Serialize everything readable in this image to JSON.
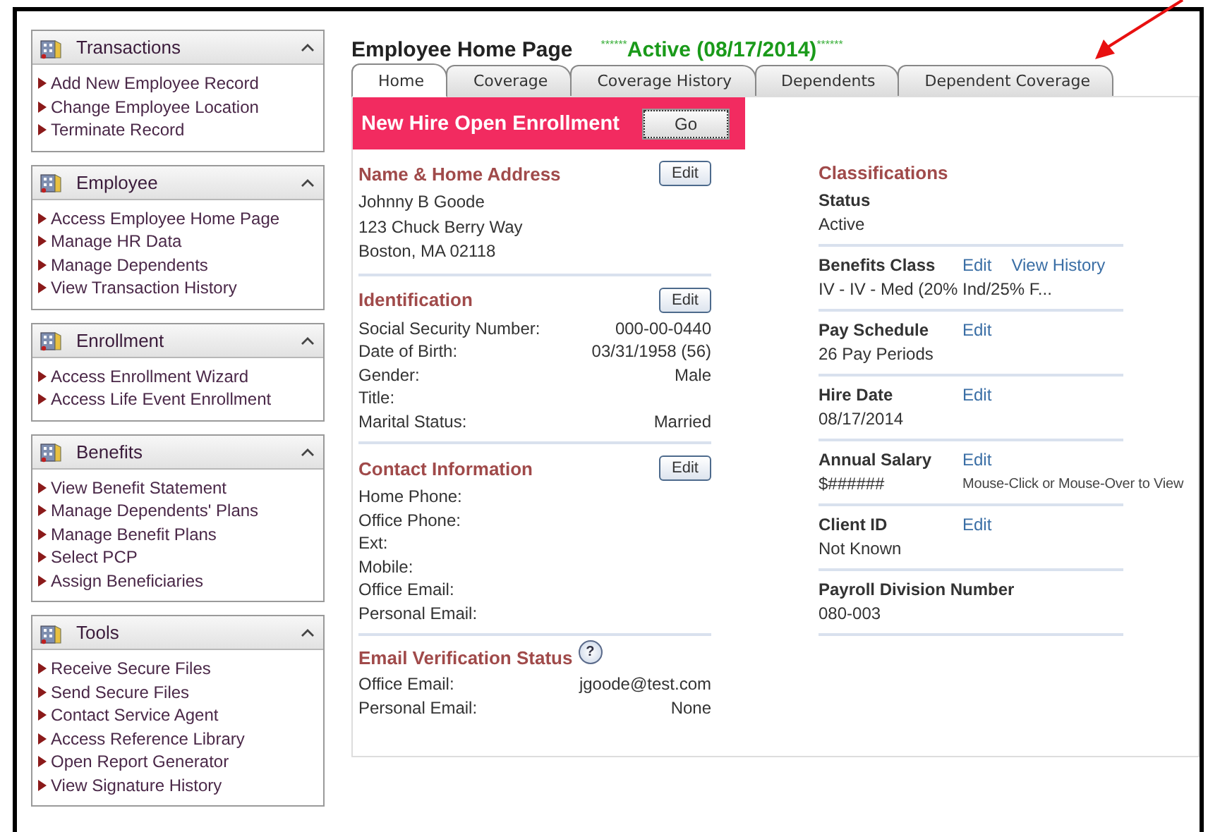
{
  "sidebar": {
    "panels": [
      {
        "title": "Transactions",
        "expanded": true,
        "items": [
          "Add New Employee Record",
          "Change Employee Location",
          "Terminate Record"
        ]
      },
      {
        "title": "Employee",
        "expanded": true,
        "items": [
          "Access Employee Home Page",
          "Manage HR Data",
          "Manage Dependents",
          "View Transaction History"
        ]
      },
      {
        "title": "Enrollment",
        "expanded": true,
        "items": [
          "Access Enrollment Wizard",
          "Access Life Event Enrollment"
        ]
      },
      {
        "title": "Benefits",
        "expanded": true,
        "items": [
          "View Benefit Statement",
          "Manage Dependents' Plans",
          "Manage Benefit Plans",
          "Select PCP",
          "Assign Beneficiaries"
        ]
      },
      {
        "title": "Tools",
        "expanded": true,
        "items": [
          "Receive Secure Files",
          "Send Secure Files",
          "Contact Service Agent",
          "Access Reference Library",
          "Open Report Generator",
          "View Signature History"
        ]
      }
    ]
  },
  "main": {
    "title": "Employee Home Page",
    "status": {
      "prefix": "******",
      "text": "Active (08/17/2014)",
      "suffix": "******"
    },
    "tabs": [
      {
        "label": "Home",
        "selected": true
      },
      {
        "label": "Coverage",
        "selected": false
      },
      {
        "label": "Coverage History",
        "selected": false
      },
      {
        "label": "Dependents",
        "selected": false
      },
      {
        "label": "Dependent Coverage",
        "selected": false
      }
    ],
    "banner": {
      "text": "New Hire Open Enrollment",
      "button": "Go"
    },
    "left_sections": [
      {
        "title": "Name & Home Address",
        "button": "Edit",
        "lines": [
          "Johnny B Goode",
          "123 Chuck Berry Way",
          "Boston, MA 02118"
        ]
      },
      {
        "title": "Identification",
        "button": "Edit",
        "rows": [
          {
            "label": "Social Security Number:",
            "value": "000-00-0440"
          },
          {
            "label": "Date of Birth:",
            "value": "03/31/1958 (56)"
          },
          {
            "label": "Gender:",
            "value": "Male"
          },
          {
            "label": "Title:"
          },
          {
            "label": "Marital Status:",
            "value": "Married"
          }
        ]
      },
      {
        "title": "Contact Information",
        "button": "Edit",
        "rows": [
          {
            "label": "Home Phone:"
          },
          {
            "label": "Office Phone:"
          },
          {
            "label": "Ext:"
          },
          {
            "label": "Mobile:"
          },
          {
            "label": "Office Email:"
          },
          {
            "label": "Personal Email:"
          }
        ]
      },
      {
        "title": "Email Verification Status",
        "help": "?",
        "rows": [
          {
            "label": "Office Email:",
            "value": "jgoode@test.com"
          },
          {
            "label": "Personal Email:",
            "value": "None"
          }
        ]
      }
    ],
    "classifications": {
      "title": "Classifications",
      "items": [
        {
          "label": "Status",
          "value": "Active"
        },
        {
          "label": "Benefits Class",
          "links": [
            "Edit",
            "View History"
          ],
          "value": "IV - IV - Med (20% Ind/25% F..."
        },
        {
          "label": "Pay Schedule",
          "links": [
            "Edit"
          ],
          "value": "26 Pay Periods"
        },
        {
          "label": "Hire Date",
          "links": [
            "Edit"
          ],
          "value": "08/17/2014"
        },
        {
          "label": "Annual Salary",
          "links": [
            "Edit"
          ],
          "value": "$######",
          "note": "Mouse-Click or Mouse-Over to View"
        },
        {
          "label": "Client ID",
          "links": [
            "Edit"
          ],
          "value": "Not Known"
        },
        {
          "label": "Payroll Division Number",
          "value": "080-003"
        }
      ]
    }
  }
}
